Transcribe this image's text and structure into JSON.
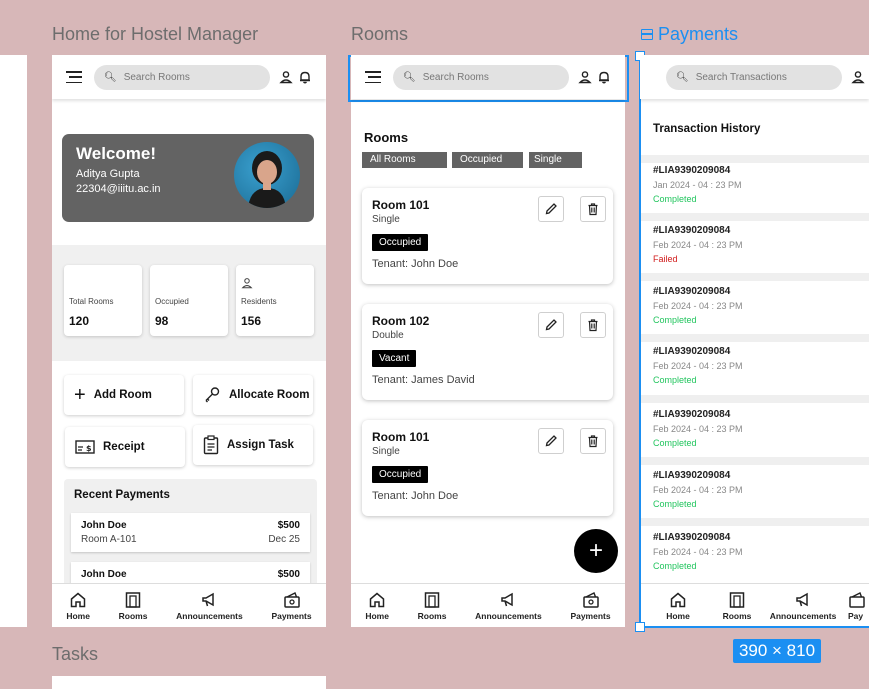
{
  "frames": {
    "home": {
      "label": "Home for Hostel Manager",
      "search_placeholder": "Search Rooms",
      "welcome": {
        "title": "Welcome!",
        "name": "Aditya Gupta",
        "email": "22304@iiitu.ac.in"
      },
      "stats": [
        {
          "label": "Total Rooms",
          "value": "120"
        },
        {
          "label": "Occupied",
          "value": "98"
        },
        {
          "label": "Residents",
          "value": "156"
        }
      ],
      "actions": {
        "add_room": "Add Room",
        "allocate_room": "Allocate Room",
        "receipt": "Receipt",
        "assign_task": "Assign Task"
      },
      "recent_payments": {
        "title": "Recent Payments",
        "items": [
          {
            "name": "John Doe",
            "room": "Room A-101",
            "amount": "$500",
            "date": "Dec 25"
          },
          {
            "name": "John Doe",
            "amount": "$500"
          }
        ]
      }
    },
    "rooms": {
      "label": "Rooms",
      "search_placeholder": "Search Rooms",
      "title": "Rooms",
      "filters": [
        "All Rooms",
        "Occupied",
        "Single"
      ],
      "cards": [
        {
          "name": "Room 101",
          "type": "Single",
          "status": "Occupied",
          "tenant": "Tenant: John Doe"
        },
        {
          "name": "Room 102",
          "type": "Double",
          "status": "Vacant",
          "tenant": "Tenant: James David"
        },
        {
          "name": "Room 101",
          "type": "Single",
          "status": "Occupied",
          "tenant": "Tenant: John Doe"
        }
      ],
      "fab": "+"
    },
    "payments": {
      "label": "Payments",
      "search_placeholder": "Search Transactions",
      "title": "Transaction History",
      "transactions": [
        {
          "id": "#LIA9390209084",
          "date": "Jan 2024 - 04 : 23 PM",
          "status": "Completed"
        },
        {
          "id": "#LIA9390209084",
          "date": "Feb 2024 - 04 : 23 PM",
          "status": "Failed"
        },
        {
          "id": "#LIA9390209084",
          "date": "Feb 2024 - 04 : 23 PM",
          "status": "Completed"
        },
        {
          "id": "#LIA9390209084",
          "date": "Feb 2024 - 04 : 23 PM",
          "status": "Completed"
        },
        {
          "id": "#LIA9390209084",
          "date": "Feb 2024 - 04 : 23 PM",
          "status": "Completed"
        },
        {
          "id": "#LIA9390209084",
          "date": "Feb 2024 - 04 : 23 PM",
          "status": "Completed"
        },
        {
          "id": "#LIA9390209084",
          "date": "Feb 2024 - 04 : 23 PM",
          "status": "Completed"
        }
      ],
      "dimension_badge": "390 × 810"
    },
    "tasks": {
      "label": "Tasks"
    }
  },
  "nav": {
    "home": "Home",
    "rooms": "Rooms",
    "announcements": "Announcements",
    "payments": "Payments",
    "payments_truncated": "Pay"
  },
  "colors": {
    "canvas": "#d7b7b8",
    "selection": "#1b8ff2",
    "completed": "#22c55e",
    "failed": "#d11a1a",
    "card_dark": "#636363"
  }
}
